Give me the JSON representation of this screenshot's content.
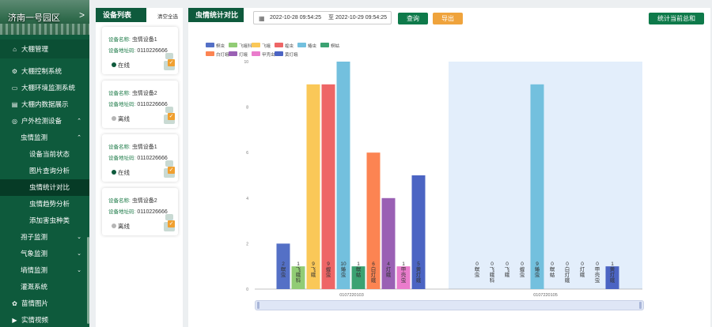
{
  "sidebar": {
    "banner_title": "济南一号园区",
    "banner_arrow": ">",
    "top_item": "大棚管理",
    "items": [
      {
        "label": "大棚控制系统",
        "level": 1,
        "icon": "gear-icon",
        "glyph": "⚙",
        "chevron": ""
      },
      {
        "label": "大棚环境监测系统",
        "level": 1,
        "icon": "monitor-icon",
        "glyph": "▭",
        "chevron": ""
      },
      {
        "label": "大棚内数据展示",
        "level": 1,
        "icon": "table-icon",
        "glyph": "▤",
        "chevron": ""
      },
      {
        "label": "户外检测设备",
        "level": 1,
        "icon": "location-icon",
        "glyph": "◎",
        "chevron": "⌃"
      },
      {
        "label": "虫情监测",
        "level": 2,
        "icon": "",
        "glyph": "",
        "chevron": "⌃"
      },
      {
        "label": "设备当前状态",
        "level": 3,
        "icon": "",
        "glyph": "",
        "chevron": ""
      },
      {
        "label": "图片查询分析",
        "level": 3,
        "icon": "",
        "glyph": "",
        "chevron": ""
      },
      {
        "label": "虫情统计对比",
        "level": 3,
        "icon": "",
        "glyph": "",
        "chevron": "",
        "active": true
      },
      {
        "label": "虫情趋势分析",
        "level": 3,
        "icon": "",
        "glyph": "",
        "chevron": ""
      },
      {
        "label": "添加害虫种类",
        "level": 3,
        "icon": "",
        "glyph": "",
        "chevron": ""
      },
      {
        "label": "孢子监测",
        "level": 2,
        "icon": "",
        "glyph": "",
        "chevron": "⌄"
      },
      {
        "label": "气象监测",
        "level": 2,
        "icon": "",
        "glyph": "",
        "chevron": "⌄"
      },
      {
        "label": "墒情监测",
        "level": 2,
        "icon": "",
        "glyph": "",
        "chevron": "⌄"
      },
      {
        "label": "灌溉系统",
        "level": 2,
        "icon": "",
        "glyph": "",
        "chevron": ""
      },
      {
        "label": "苗情图片",
        "level": 1,
        "icon": "plant-icon",
        "glyph": "✿",
        "chevron": ""
      },
      {
        "label": "实情视频",
        "level": 1,
        "icon": "video-icon",
        "glyph": "▶",
        "chevron": ""
      }
    ]
  },
  "devices": {
    "title": "设备列表",
    "clear_label": "清空全选",
    "name_label": "设备名称:",
    "addr_label": "设备地址码:",
    "cards": [
      {
        "name": "虫情设备1",
        "addr": "0110226666",
        "status": "在线",
        "color": "#0e5a3c"
      },
      {
        "name": "虫情设备2",
        "addr": "0110226666",
        "status": "离线",
        "color": "#b5b5b5"
      },
      {
        "name": "虫情设备1",
        "addr": "0110226666",
        "status": "在线",
        "color": "#0e5a3c"
      },
      {
        "name": "虫情设备2",
        "addr": "0110226666",
        "status": "离线",
        "color": "#b5b5b5"
      }
    ]
  },
  "main": {
    "title": "虫情统计对比",
    "date_start": "2022-10-28 09:54:25",
    "date_sep": "至",
    "date_end": "2022-10-29 09:54:25",
    "query_label": "查询",
    "export_label": "导出",
    "stat_label": "统计当前总和"
  },
  "chart_data": {
    "type": "bar",
    "ylim": [
      0,
      10
    ],
    "ytick_labels": [
      "0",
      "2",
      "4",
      "6",
      "8",
      "10"
    ],
    "groups": [
      "0107220103",
      "0107220105"
    ],
    "legend": [
      {
        "name": "螟虫",
        "color": "#5470c6"
      },
      {
        "name": "飞蛾科",
        "color": "#91cc75"
      },
      {
        "name": "飞蛾",
        "color": "#fac858"
      },
      {
        "name": "蝗虫",
        "color": "#ee6666"
      },
      {
        "name": "蝽虫",
        "color": "#73c0de"
      },
      {
        "name": "螟蛄",
        "color": "#3ba272"
      },
      {
        "name": "白灯蛾",
        "color": "#fc8452"
      },
      {
        "name": "灯蛾",
        "color": "#9a60b4"
      },
      {
        "name": "甲壳虫",
        "color": "#ea7ccc"
      },
      {
        "name": "黄灯蛾",
        "color": "#4b64c3"
      }
    ],
    "bar_labels": [
      "2 螟虫",
      "1 飞蛾科",
      "9 飞蛾",
      "9 蝗虫",
      "10 蝽虫",
      "1 螟蛄",
      "6 白灯蛾",
      "4 灯蛾",
      "1 甲壳虫",
      "5 黄灯蛾",
      "0 螟虫",
      "0 飞蛾科",
      "0 飞蛾",
      "0 蝗虫",
      "9 蝽虫",
      "0 螟蛄",
      "0 白灯蛾",
      "0 灯蛾",
      "0 甲壳虫",
      "1 黄灯蛾"
    ],
    "series": [
      {
        "values": [
          2,
          1,
          9,
          9,
          10,
          1,
          6,
          4,
          1,
          5
        ]
      },
      {
        "values": [
          0,
          0,
          0,
          0,
          9,
          0,
          0,
          0,
          0,
          1
        ]
      }
    ],
    "highlight_group": 1,
    "highlight_color": "#e3eefb"
  }
}
